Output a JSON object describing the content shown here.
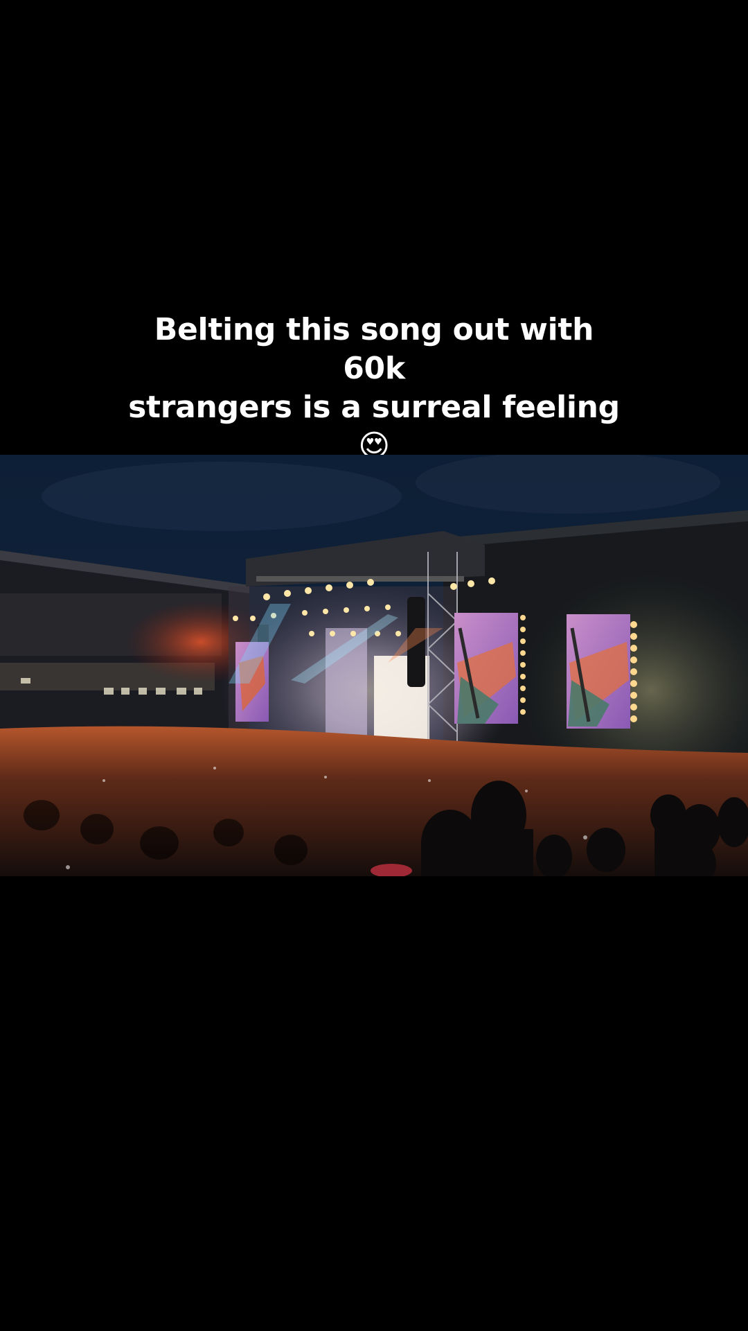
{
  "caption": {
    "line1": "Belting this song out with 60k",
    "line2": "strangers is a surreal feeling 😍",
    "line3": "🤠"
  },
  "colors": {
    "background": "#000000",
    "caption_text": "#ffffff"
  }
}
